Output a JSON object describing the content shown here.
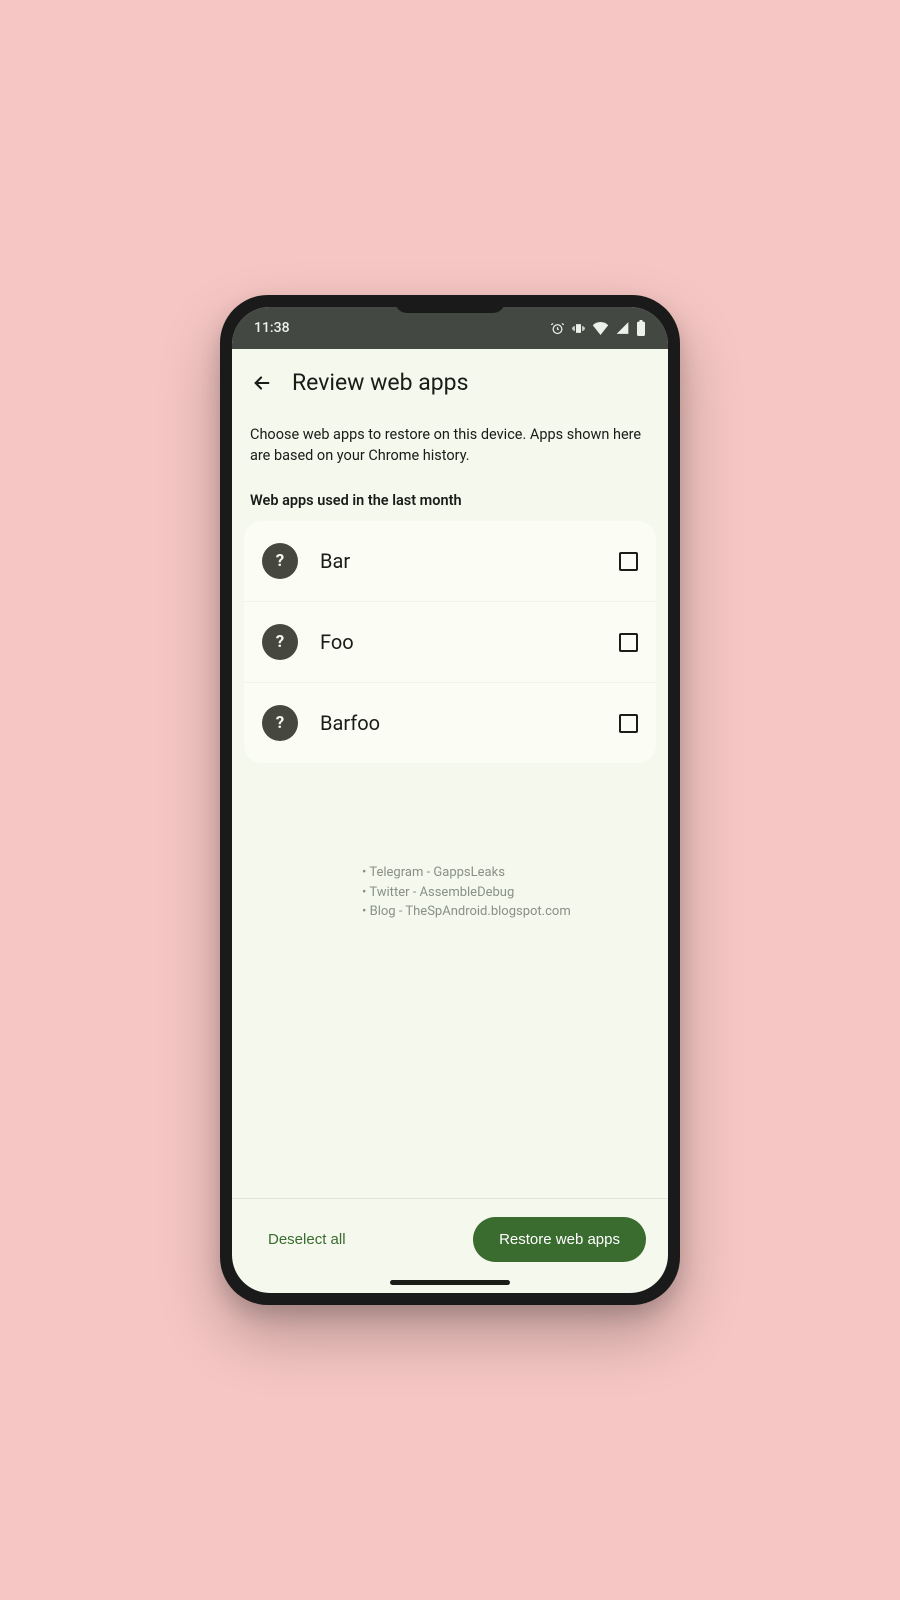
{
  "status": {
    "time": "11:38"
  },
  "header": {
    "title": "Review web apps"
  },
  "description": "Choose web apps to restore on this device. Apps shown here are based on your Chrome history.",
  "section_label": "Web apps used in the last month",
  "apps": [
    {
      "name": "Bar",
      "icon_glyph": "?"
    },
    {
      "name": "Foo",
      "icon_glyph": "?"
    },
    {
      "name": "Barfoo",
      "icon_glyph": "?"
    }
  ],
  "credits": [
    "Telegram - GappsLeaks",
    "Twitter - AssembleDebug",
    "Blog - TheSpAndroid.blogspot.com"
  ],
  "actions": {
    "deselect": "Deselect all",
    "restore": "Restore web apps"
  }
}
